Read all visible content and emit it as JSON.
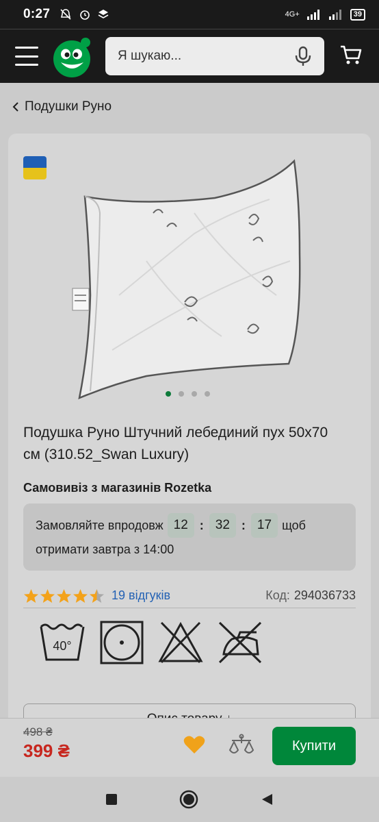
{
  "status_bar": {
    "time": "0:27",
    "network": "4G+",
    "battery": "39"
  },
  "header": {
    "search_placeholder": "Я шукаю..."
  },
  "breadcrumb": {
    "label": "Подушки Руно"
  },
  "product": {
    "title": "Подушка Руно Штучний лебединий пух 50x70 см (310.52_Swan Luxury)",
    "pickup_label": "Самовивіз з магазинів Rozetka",
    "timer": {
      "prefix": "Замовляйте впродовж",
      "hours": "12",
      "minutes": "32",
      "seconds": "17",
      "suffix": "щоб",
      "line2": "отримати завтра з 14:00"
    },
    "rating": 4.5,
    "reviews": "19 відгуків",
    "code_label": "Код:",
    "code_value": "294036733",
    "care_temp": "40°",
    "description_button": "Опис товару ↓",
    "image_count": 4,
    "active_image": 1
  },
  "bottom_bar": {
    "old_price": "498 ₴",
    "price": "399 ₴",
    "buy_label": "Купити"
  },
  "colors": {
    "accent": "#00873a",
    "price": "#c7271f",
    "link": "#2462b4",
    "star": "#f3a21a",
    "heart": "#f0a21a"
  }
}
